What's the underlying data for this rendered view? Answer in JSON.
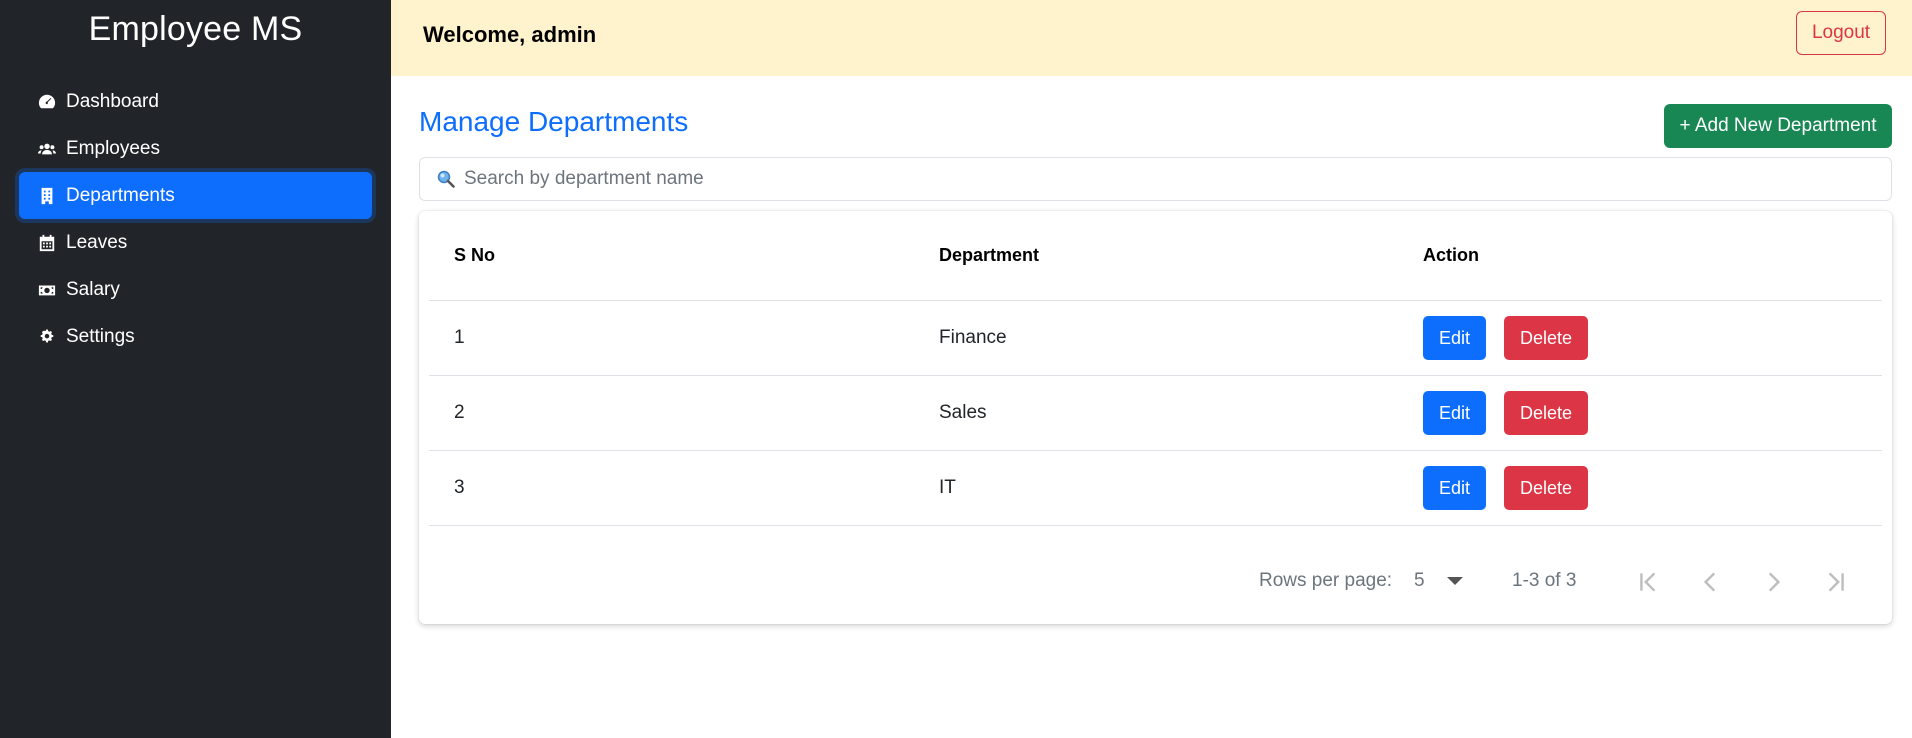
{
  "app": {
    "brand": "Employee MS"
  },
  "sidebar": {
    "items": [
      {
        "label": "Dashboard",
        "icon": "dashboard-icon"
      },
      {
        "label": "Employees",
        "icon": "users-icon"
      },
      {
        "label": "Departments",
        "icon": "building-icon",
        "active": true
      },
      {
        "label": "Leaves",
        "icon": "calendar-icon"
      },
      {
        "label": "Salary",
        "icon": "money-icon"
      },
      {
        "label": "Settings",
        "icon": "gear-icon"
      }
    ]
  },
  "header": {
    "welcome": "Welcome, admin",
    "logout_label": "Logout"
  },
  "main": {
    "title": "Manage Departments",
    "add_button": "+ Add New Department",
    "search": {
      "placeholder": "Search by department name",
      "value": ""
    },
    "table": {
      "headers": [
        "S No",
        "Department",
        "Action"
      ],
      "rows": [
        {
          "sno": "1",
          "department": "Finance"
        },
        {
          "sno": "2",
          "department": "Sales"
        },
        {
          "sno": "3",
          "department": "IT"
        }
      ],
      "edit_label": "Edit",
      "delete_label": "Delete"
    },
    "pagination": {
      "rows_per_page_label": "Rows per page:",
      "rows_per_page": "5",
      "range": "1-3 of 3"
    }
  },
  "colors": {
    "sidebar_bg": "#212529",
    "accent": "#0d6efd",
    "header_bg": "#fff3cd",
    "success": "#198754",
    "danger": "#dc3545"
  }
}
